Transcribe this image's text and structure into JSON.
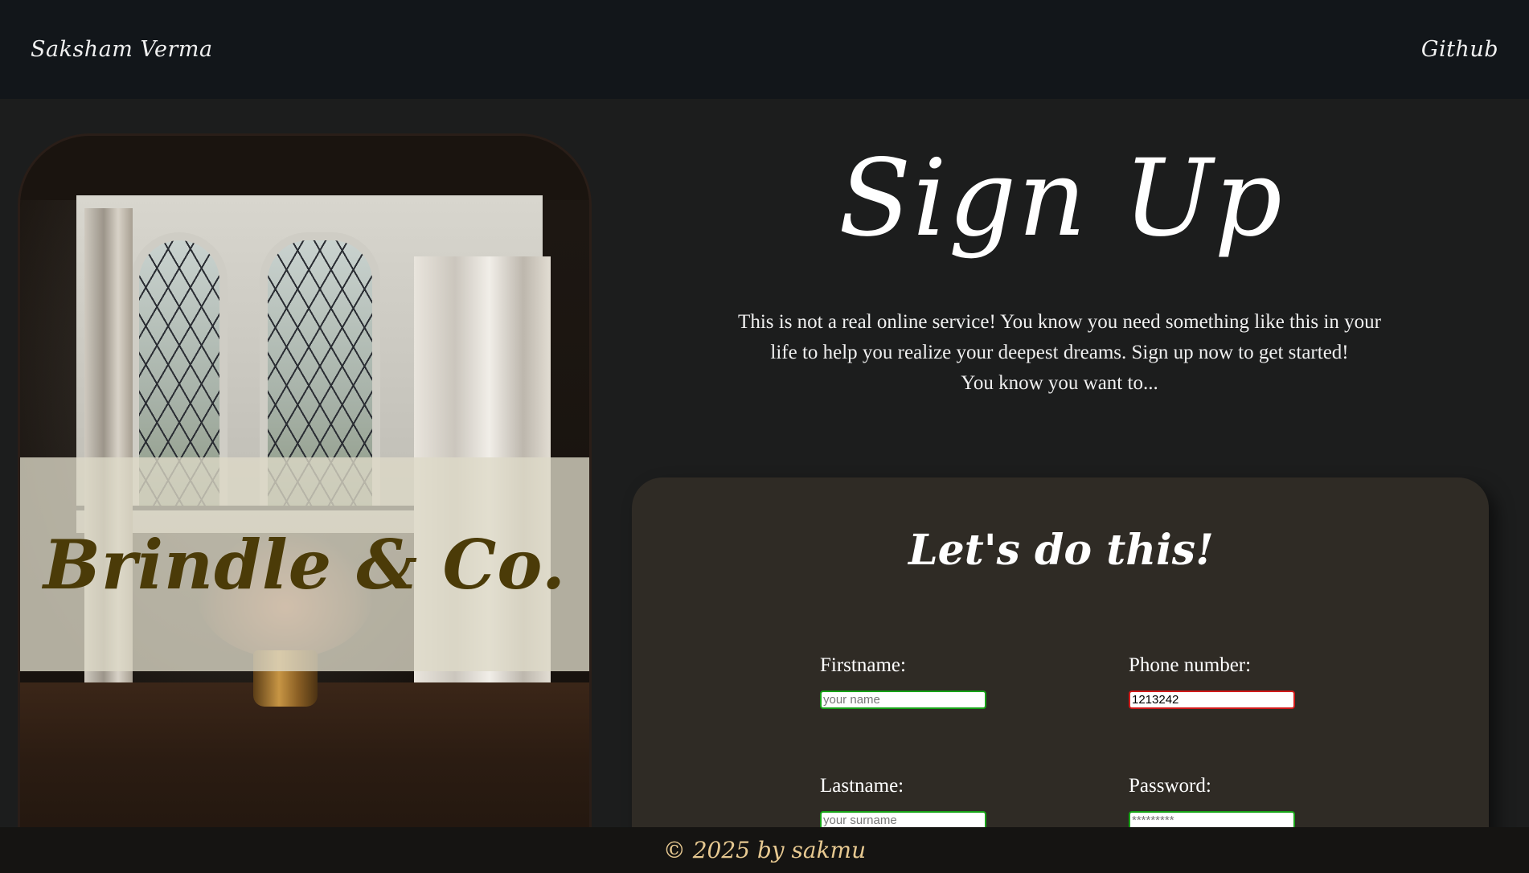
{
  "header": {
    "brand": "Saksham Verma",
    "github_link": "Github"
  },
  "hero_image": {
    "banner_text": "Brindle & Co."
  },
  "main": {
    "title": "Sign Up",
    "intro_line1": "This is not a real online service! You know you need something like this in your life to help you realize your deepest dreams. Sign up now to get started!",
    "intro_line2": "You know you want to..."
  },
  "form": {
    "title": "Let's do this!",
    "firstname": {
      "label": "Firstname:",
      "placeholder": "your name",
      "value": ""
    },
    "phone": {
      "label": "Phone number:",
      "placeholder": "",
      "value": "1213242"
    },
    "lastname": {
      "label": "Lastname:",
      "placeholder": "your surname",
      "value": ""
    },
    "password": {
      "label": "Password:",
      "placeholder": "*********",
      "value": ""
    }
  },
  "footer": {
    "text": "© 2025 by sakmu"
  },
  "colors": {
    "header_bg": "#12161a",
    "page_bg": "#1c1d1d",
    "panel_bg": "#2f2b25",
    "valid_border": "#17a317",
    "invalid_border": "#d11a1a",
    "footer_text": "#e7c991",
    "banner_text": "#4b3b08"
  }
}
